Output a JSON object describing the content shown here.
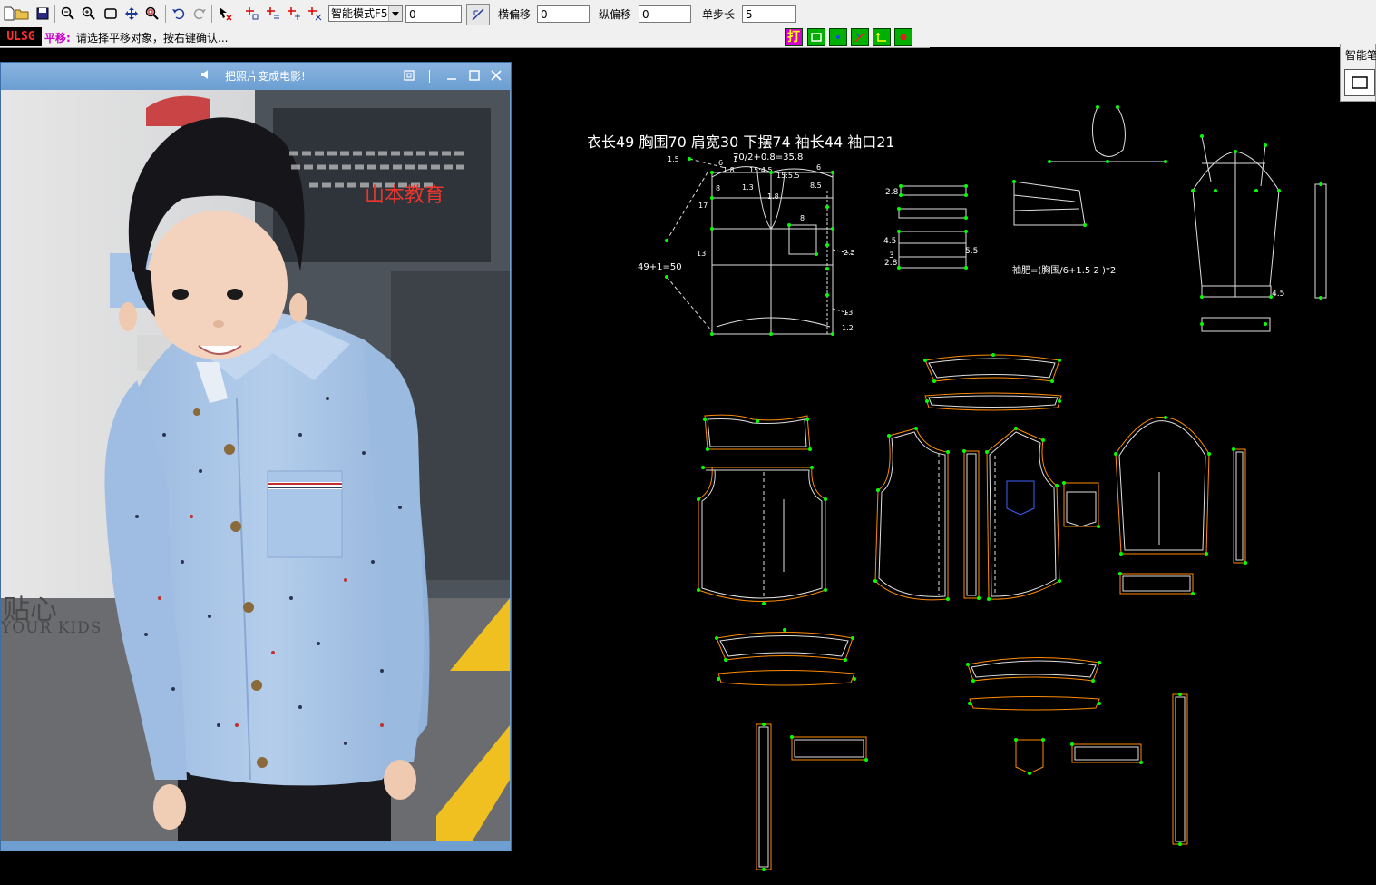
{
  "toolbar": {
    "mode_select": "智能模式F5",
    "value_field": "0",
    "h_offset_label": "横偏移",
    "h_offset_value": "0",
    "v_offset_label": "纵偏移",
    "v_offset_value": "0",
    "step_label": "单步长",
    "step_value": "5"
  },
  "statusbar": {
    "logo": "ULSG",
    "mode": "平移:",
    "message": "请选择平移对象，按右键确认..."
  },
  "quick_tools": {
    "print_label": "打"
  },
  "photo_window": {
    "title": "把照片变成电影!",
    "watermark": "山本教育",
    "wall_text_cn": "贴心",
    "wall_text_en": "YOUR KIDS"
  },
  "side_panel": {
    "title": "智能笔"
  },
  "pattern": {
    "measurements": "衣长49    胸围70    肩宽30    下摆74    袖长44    袖口21",
    "chest_formula": "70/2+0.8=35.8",
    "length_formula": "49+1=50",
    "sleeve_formula": "袖肥=(胸围/6+1.5   2   )*2",
    "labels": [
      "1.5",
      "6",
      "1",
      "1.8",
      "15:4.5",
      "15:5.5",
      "6",
      "8",
      "1.3",
      "1.8",
      "8.5",
      "17",
      "8",
      "13",
      "2.5",
      "13",
      "1.2",
      "2.8",
      "4.5",
      "3",
      "2.8",
      "5.5",
      "4.5"
    ]
  },
  "colors": {
    "toolbar_bg": "#f0f0f0",
    "canvas_bg": "#000000",
    "line_white": "#e8e8e8",
    "point_green": "#00ff00",
    "seam_orange": "#ff8c00",
    "text_white": "#ffffff",
    "status_magenta": "#c800c8",
    "window_blue": "#6d9fd3"
  }
}
